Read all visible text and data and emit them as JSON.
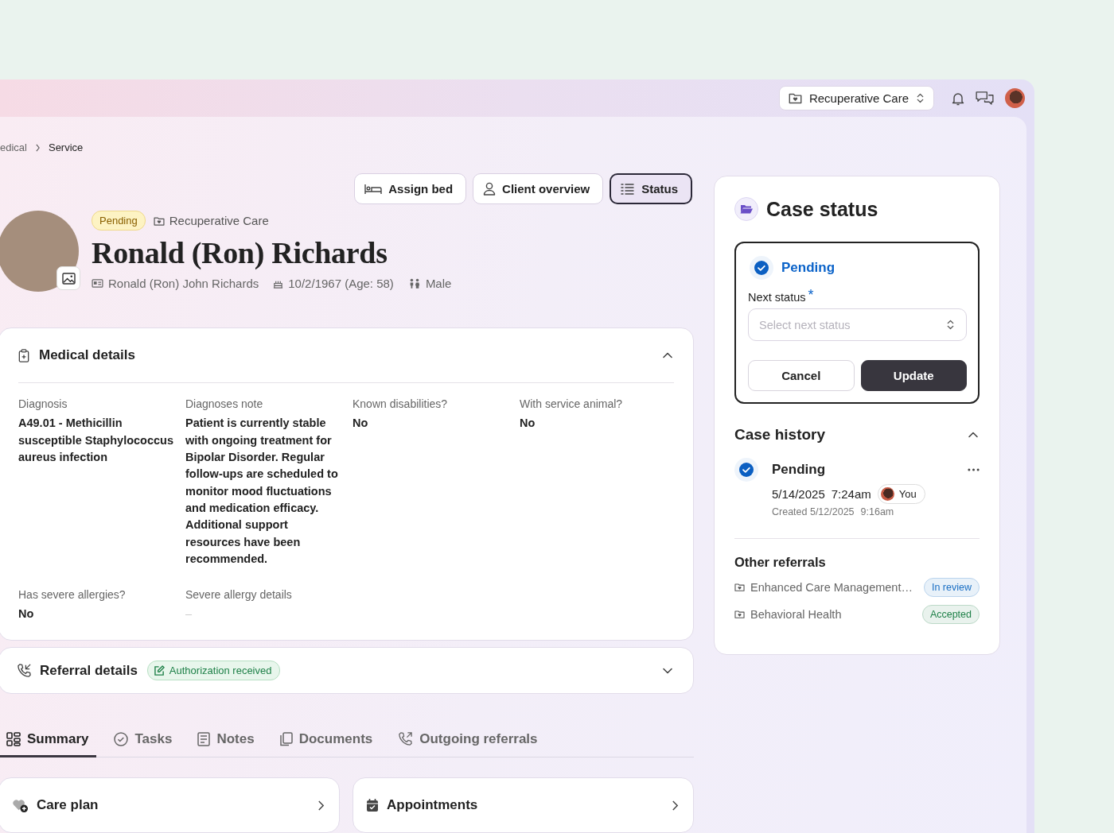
{
  "top_bar": {
    "program_selector": "Recuperative Care"
  },
  "breadcrumb": [
    "edical",
    "Service"
  ],
  "actions": [
    {
      "label": "Assign bed",
      "selected": false
    },
    {
      "label": "Client overview",
      "selected": false
    },
    {
      "label": "Status",
      "selected": true
    }
  ],
  "client": {
    "status_badge": "Pending",
    "program": "Recuperative Care",
    "name": "Ronald (Ron) Richards",
    "full_name": "Ronald (Ron) John Richards",
    "birth_date": "10/2/1967 (Age: 58)",
    "gender": "Male"
  },
  "medical_details": {
    "title": "Medical details",
    "expanded": true,
    "fields": [
      {
        "label": "Diagnosis",
        "value": "A49.01 - Methicillin susceptible Staphylococcus aureus infection"
      },
      {
        "label": "Diagnoses note",
        "value": "Patient is currently stable with ongoing treatment for Bipolar Disorder. Regular follow-ups are scheduled to monitor mood fluctuations and medication efficacy. Additional support resources have been recommended."
      },
      {
        "label": "Known disabilities?",
        "value": "No"
      },
      {
        "label": "With service animal?",
        "value": "No"
      },
      {
        "label": "Has severe allergies?",
        "value": "No"
      },
      {
        "label": "Severe allergy details",
        "placeholder": "–"
      }
    ]
  },
  "referral_details": {
    "title": "Referral details",
    "badge": "Authorization received",
    "expanded": false
  },
  "tabs": [
    {
      "label": "Summary",
      "selected": true
    },
    {
      "label": "Tasks",
      "selected": false
    },
    {
      "label": "Notes",
      "selected": false
    },
    {
      "label": "Documents",
      "selected": false
    },
    {
      "label": "Outgoing referrals",
      "selected": false
    }
  ],
  "summary_cards": [
    {
      "title": "Care plan"
    },
    {
      "title": "Appointments"
    }
  ],
  "case_status": {
    "title": "Case status",
    "current_status": "Pending",
    "next_status_label": "Next status",
    "required_mark": "*",
    "placeholder": "Select next status",
    "buttons": [
      "Cancel",
      "Update"
    ]
  },
  "case_history": {
    "title": "Case history",
    "expanded": true,
    "entries": [
      {
        "status": "Pending",
        "date": "5/14/2025",
        "time": "7:24am",
        "user": "You",
        "created_date": "Created 5/12/2025",
        "created_time": "9:16am"
      }
    ]
  },
  "other_referrals": {
    "title": "Other referrals",
    "items": [
      {
        "name": "Enhanced Care Management…",
        "status": "In review",
        "color": "#1a6fc4"
      },
      {
        "name": "Behavioral Health",
        "status": "Accepted",
        "color": "#1e8048"
      }
    ]
  }
}
